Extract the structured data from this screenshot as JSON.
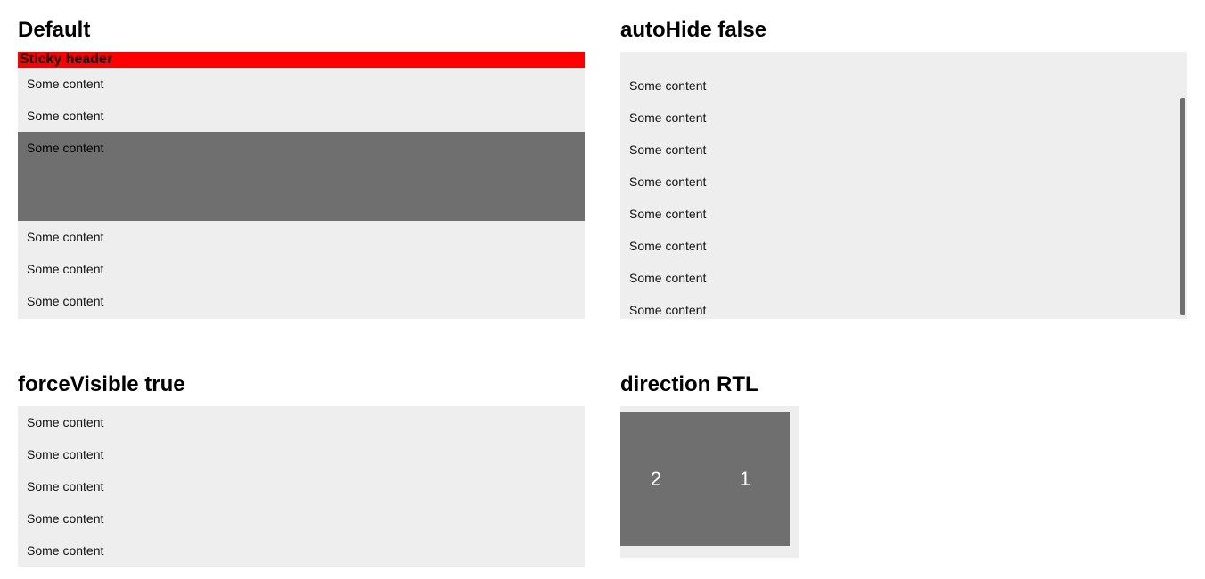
{
  "sections": {
    "default": {
      "title": "Default",
      "sticky": "Sticky header",
      "items": [
        "Some content",
        "Some content",
        "Some content",
        "Some content",
        "Some content",
        "Some content"
      ]
    },
    "autohide": {
      "title": "autoHide false",
      "items": [
        "Some content",
        "Some content",
        "Some content",
        "Some content",
        "Some content",
        "Some content",
        "Some content",
        "Some content"
      ]
    },
    "forcevisible": {
      "title": "forceVisible true",
      "items": [
        "Some content",
        "Some content",
        "Some content",
        "Some content",
        "Some content"
      ]
    },
    "rtl": {
      "title": "direction RTL",
      "cells": [
        "1",
        "2"
      ]
    }
  }
}
